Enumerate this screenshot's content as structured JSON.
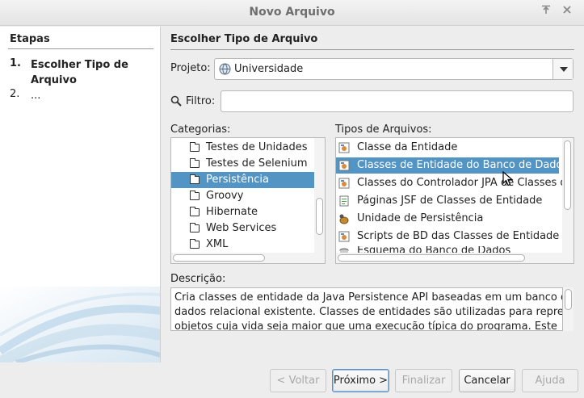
{
  "window": {
    "title": "Novo Arquivo",
    "controls": [
      "pin-icon",
      "close-icon"
    ]
  },
  "steps": {
    "header": "Etapas",
    "items": [
      {
        "num": "1.",
        "label": "Escolher Tipo de Arquivo",
        "current": true
      },
      {
        "num": "2.",
        "label": "...",
        "current": false
      }
    ]
  },
  "main": {
    "title": "Escolher Tipo de Arquivo",
    "project_label": "Projeto:",
    "project_value": "Universidade",
    "filter_label": "Filtro:",
    "filter_value": "",
    "categories_label": "Categorias:",
    "categories": [
      {
        "label": "Testes de Unidades",
        "selected": false
      },
      {
        "label": "Testes de Selenium",
        "selected": false
      },
      {
        "label": "Persistência",
        "selected": true
      },
      {
        "label": "Groovy",
        "selected": false
      },
      {
        "label": "Hibernate",
        "selected": false
      },
      {
        "label": "Web Services",
        "selected": false
      },
      {
        "label": "XML",
        "selected": false
      }
    ],
    "filetypes_label": "Tipos de Arquivos:",
    "filetypes": [
      {
        "label": "Classe da Entidade",
        "icon": "entity-class-icon",
        "selected": false
      },
      {
        "label": "Classes de Entidade do Banco de Dados",
        "icon": "entity-db-icon",
        "selected": true
      },
      {
        "label": "Classes do Controlador JPA de Classes de E",
        "icon": "jpa-controller-icon",
        "selected": false
      },
      {
        "label": "Páginas JSF de Classes de Entidade",
        "icon": "jsf-pages-icon",
        "selected": false
      },
      {
        "label": "Unidade de Persistência",
        "icon": "persistence-unit-icon",
        "selected": false
      },
      {
        "label": "Scripts de BD das Classes de Entidade",
        "icon": "db-script-icon",
        "selected": false
      },
      {
        "label": "Esquema do Banco de Dados",
        "icon": "db-schema-icon",
        "selected": false
      }
    ],
    "description_label": "Descrição:",
    "description_lines": [
      "Cria classes de entidade da Java Persistence API baseadas em um banco de",
      "dados relacional existente. Classes de entidades são utilizadas para representar",
      "objetos cuja vida seja maior que uma execução típica do programa. Este"
    ]
  },
  "buttons": {
    "back": "< Voltar",
    "next": "Próximo >",
    "finish": "Finalizar",
    "cancel": "Cancelar",
    "help": "Ajuda"
  }
}
